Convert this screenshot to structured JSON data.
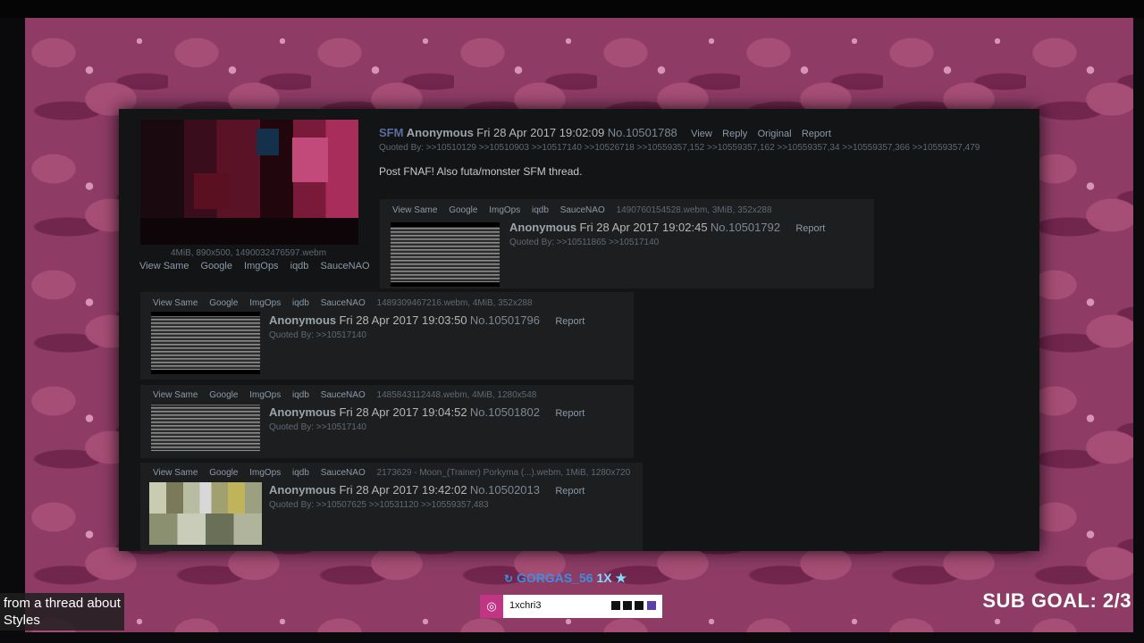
{
  "op": {
    "subject": "SFM",
    "name": "Anonymous",
    "date": "Fri 28 Apr 2017 19:02:09",
    "post_no": "No.10501788",
    "actions": [
      "View",
      "Reply",
      "Original",
      "Report"
    ],
    "quoted_by": "Quoted By: >>10510129 >>10510903 >>10517140 >>10526718 >>10559357,152 >>10559357,162 >>10559357,34 >>10559357,366 >>10559357,479",
    "message": "Post FNAF! Also futa/monster SFM thread.",
    "file_info": "4MiB, 890x500, 1490032476597.webm",
    "file_links": [
      "View Same",
      "Google",
      "ImgOps",
      "iqdb",
      "SauceNAO"
    ]
  },
  "replies": [
    {
      "file_links": [
        "View Same",
        "Google",
        "ImgOps",
        "iqdb",
        "SauceNAO"
      ],
      "file_info": "1490760154528.webm, 3MiB, 352x288",
      "name": "Anonymous",
      "date": "Fri 28 Apr 2017 19:02:45",
      "post_no": "No.10501792",
      "report": "Report",
      "quoted_by": "Quoted By: >>10511865 >>10517140"
    },
    {
      "file_links": [
        "View Same",
        "Google",
        "ImgOps",
        "iqdb",
        "SauceNAO"
      ],
      "file_info": "1489309467216.webm, 4MiB, 352x288",
      "name": "Anonymous",
      "date": "Fri 28 Apr 2017 19:03:50",
      "post_no": "No.10501796",
      "report": "Report",
      "quoted_by": "Quoted By: >>10517140"
    },
    {
      "file_links": [
        "View Same",
        "Google",
        "ImgOps",
        "iqdb",
        "SauceNAO"
      ],
      "file_info": "1485843112448.webm, 4MiB, 1280x548",
      "name": "Anonymous",
      "date": "Fri 28 Apr 2017 19:04:52",
      "post_no": "No.10501802",
      "report": "Report",
      "quoted_by": "Quoted By: >>10517140"
    },
    {
      "file_links": [
        "View Same",
        "Google",
        "ImgOps",
        "iqdb",
        "SauceNAO"
      ],
      "file_info": "2173629 - Moon_(Trainer) Porkyma (...).webm, 1MiB, 1280x720",
      "name": "Anonymous",
      "date": "Fri 28 Apr 2017 19:42:02",
      "post_no": "No.10502013",
      "report": "Report",
      "quoted_by": "Quoted By: >>10507625 >>10531120 >>10559357,483"
    }
  ],
  "overlay": {
    "caption_line1": "from a thread about",
    "caption_line2": "Styles",
    "sub_goal": "SUB GOAL: 2/3",
    "gift_user": "GORGAS_56",
    "gift_mult": "1X",
    "instagram_handle": "1xchri3"
  },
  "colors": {
    "background": "#8e3c66",
    "thread_bg": "#131415",
    "reply_bg": "#1c1e20",
    "gift_blue": "#3a8fe0",
    "instagram": "#c13584"
  }
}
